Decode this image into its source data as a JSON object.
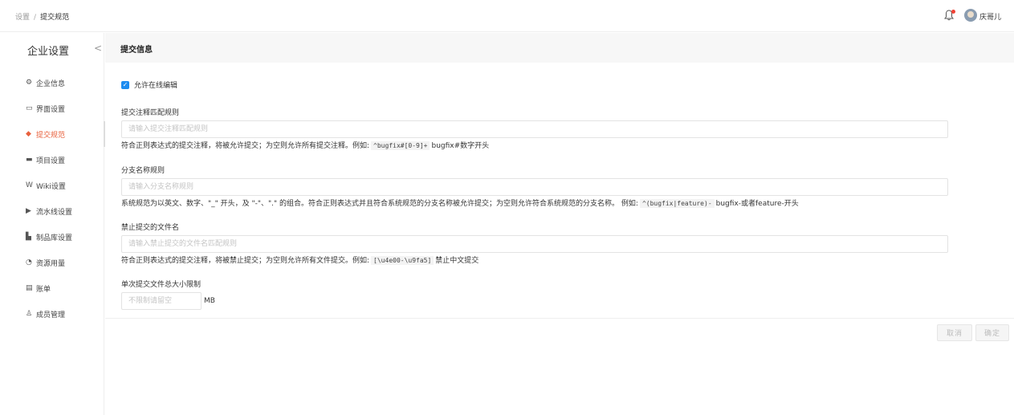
{
  "breadcrumb": {
    "parent": "设置",
    "separator": "/",
    "current": "提交规范"
  },
  "user": {
    "name": "庆哥儿"
  },
  "icons": {
    "bell": "bell-icon",
    "avatar": "user-avatar"
  },
  "colors": {
    "accent": "#e8603c",
    "checkbox": "#1d8cf0",
    "notification_dot": "#f04134"
  },
  "sidebar": {
    "title": "企业设置",
    "collapse_glyph": "<",
    "items": [
      {
        "label": "企业信息",
        "icon": "⚙"
      },
      {
        "label": "界面设置",
        "icon": "▭"
      },
      {
        "label": "提交规范",
        "icon": "◆",
        "active": true
      },
      {
        "label": "项目设置",
        "icon": "▬"
      },
      {
        "label": "Wiki设置",
        "icon": "W"
      },
      {
        "label": "流水线设置",
        "icon": "▶"
      },
      {
        "label": "制品库设置",
        "icon": "▙"
      },
      {
        "label": "资源用量",
        "icon": "◔"
      },
      {
        "label": "账单",
        "icon": "▤"
      },
      {
        "label": "成员管理",
        "icon": "♙"
      }
    ]
  },
  "main": {
    "section_title": "提交信息",
    "allow_online_edit": {
      "label": "允许在线编辑",
      "checked": true
    },
    "commit_rule": {
      "label": "提交注释匹配规则",
      "placeholder": "请输入提交注释匹配规则",
      "hint_prefix": "符合正则表达式的提交注释，将被允许提交；为空则允许所有提交注释。例如:",
      "hint_code": "^bugfix#[0-9]+",
      "hint_suffix": "bugfix#数字开头"
    },
    "branch_rule": {
      "label": "分支名称规则",
      "placeholder": "请输入分支名称规则",
      "hint_prefix": "系统规范为以英文、数字、\"_\" 开头，及 \"-\"、\".\" 的组合。符合正则表达式并且符合系统规范的分支名称被允许提交；为空则允许符合系统规范的分支名称。 例如:",
      "hint_code": "^(bugfix|feature)-",
      "hint_suffix": "bugfix-或者feature-开头"
    },
    "forbidden_files": {
      "label": "禁止提交的文件名",
      "placeholder": "请输入禁止提交的文件名匹配规则",
      "hint_prefix": "符合正则表达式的提交注释，将被禁止提交；为空则允许所有文件提交。例如:",
      "hint_code": "[\\u4e00-\\u9fa5]",
      "hint_suffix": "禁止中文提交"
    },
    "size_limit": {
      "label": "单次提交文件总大小限制",
      "placeholder": "不限制请留空",
      "unit": "MB"
    },
    "buttons": {
      "cancel": "取消",
      "confirm": "确定"
    }
  }
}
